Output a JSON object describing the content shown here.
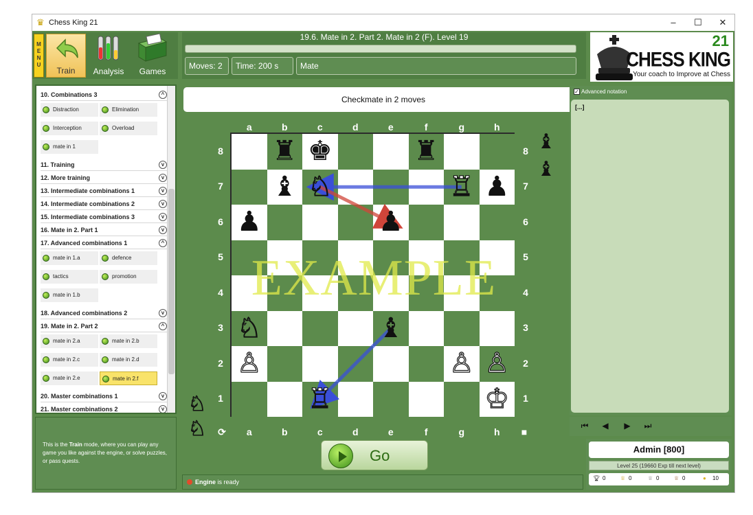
{
  "window": {
    "title": "Chess King 21",
    "minimize": "–",
    "maximize": "☐",
    "close": "✕"
  },
  "toolbar": {
    "menu_label": "MENU",
    "train": "Train",
    "analysis": "Analysis",
    "games": "Games"
  },
  "header": {
    "puzzle_title": "19.6. Mate in 2. Part 2. Mate in 2 (F). Level 19",
    "moves_label": "Moves:",
    "moves_value": "2",
    "time_label": "Time:",
    "time_value": "200 s",
    "mode": "Mate"
  },
  "logo": {
    "number": "21",
    "name": "CHESS KING",
    "tagline": "Your coach to Improve at Chess"
  },
  "lessons": [
    {
      "label": "10. Combinations 3",
      "state": "open",
      "subs": [
        [
          "Distraction",
          "Elimination"
        ],
        [
          "Interception",
          "Overload"
        ],
        [
          "mate in 1"
        ]
      ]
    },
    {
      "label": "11. Training",
      "state": "closed"
    },
    {
      "label": "12. More training",
      "state": "closed"
    },
    {
      "label": "13. Intermediate combinations 1",
      "state": "closed"
    },
    {
      "label": "14. Intermediate combinations 2",
      "state": "closed"
    },
    {
      "label": "15. Intermediate combinations 3",
      "state": "closed"
    },
    {
      "label": "16. Mate in 2. Part 1",
      "state": "closed"
    },
    {
      "label": "17. Advanced combinations 1",
      "state": "open",
      "subs": [
        [
          "mate in 1.a",
          "defence"
        ],
        [
          "tactics",
          "promotion"
        ],
        [
          "mate in 1.b"
        ]
      ]
    },
    {
      "label": "18. Advanced combinations 2",
      "state": "closed"
    },
    {
      "label": "19. Mate in 2. Part 2",
      "state": "open",
      "subs": [
        [
          "mate in 2.a",
          "mate in 2.b"
        ],
        [
          "mate in 2.c",
          "mate in 2.d"
        ],
        [
          "mate in 2.e",
          "mate in 2.f"
        ]
      ]
    },
    {
      "label": "20. Master combinations 1",
      "state": "closed"
    },
    {
      "label": "21. Master combinations 2",
      "state": "closed"
    }
  ],
  "selected_lesson": "mate in 2.f",
  "info": {
    "pre": "This is the ",
    "bold": "Train",
    "post": " mode, where you can play any game you like against the engine, or solve puzzles, or pass quests."
  },
  "task": "Checkmate in 2 moves",
  "board": {
    "files": [
      "a",
      "b",
      "c",
      "d",
      "e",
      "f",
      "g",
      "h"
    ],
    "ranks": [
      "8",
      "7",
      "6",
      "5",
      "4",
      "3",
      "2",
      "1"
    ],
    "watermark": "EXAMPLE",
    "pieces": [
      {
        "square": "b8",
        "glyph": "♜",
        "color": "b"
      },
      {
        "square": "c8",
        "glyph": "♚",
        "color": "b"
      },
      {
        "square": "f8",
        "glyph": "♜",
        "color": "b"
      },
      {
        "square": "b7",
        "glyph": "♝",
        "color": "b"
      },
      {
        "square": "c7",
        "glyph": "♘",
        "color": "w"
      },
      {
        "square": "g7",
        "glyph": "♖",
        "color": "w"
      },
      {
        "square": "h7",
        "glyph": "♟",
        "color": "b"
      },
      {
        "square": "a6",
        "glyph": "♟",
        "color": "b"
      },
      {
        "square": "e6",
        "glyph": "♟",
        "color": "b"
      },
      {
        "square": "a3",
        "glyph": "♘",
        "color": "w"
      },
      {
        "square": "e3",
        "glyph": "♝",
        "color": "b"
      },
      {
        "square": "a2",
        "glyph": "♙",
        "color": "w"
      },
      {
        "square": "g2",
        "glyph": "♙",
        "color": "w"
      },
      {
        "square": "h2",
        "glyph": "♙",
        "color": "w"
      },
      {
        "square": "c1",
        "glyph": "♖",
        "color": "w"
      },
      {
        "square": "h1",
        "glyph": "♔",
        "color": "w"
      }
    ],
    "arrows": [
      {
        "from": "g7",
        "to": "c7",
        "color": "#3a4fd8"
      },
      {
        "from": "c7",
        "to": "e6",
        "color": "#d0453a"
      },
      {
        "from": "e3",
        "to": "c1",
        "color": "#3a4fd8"
      }
    ],
    "captured_black": [
      "♝",
      "♝"
    ],
    "side_white": [
      "♘",
      "♘"
    ],
    "rotate_icon": "⟳",
    "turn_marker": "■"
  },
  "go_button": "Go",
  "status": {
    "bold": "Engine",
    "text": " is ready"
  },
  "notation": {
    "advanced_label": "Advanced notation",
    "content": "[...]"
  },
  "nav": {
    "first": "⏮",
    "prev": "◀",
    "next": "▶",
    "last": "⏭"
  },
  "user": {
    "name": "Admin [800]",
    "level": "Level 25 (19660 Exp till next level)",
    "stats": [
      "0",
      "0",
      "0",
      "0",
      "10"
    ]
  }
}
